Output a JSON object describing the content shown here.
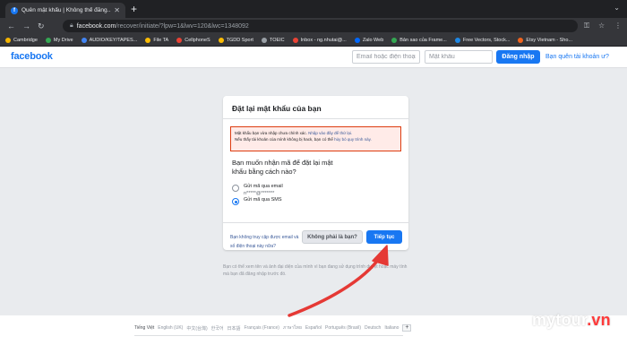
{
  "browser": {
    "tab_title": "Quên mật khẩu | Không thể đăng...",
    "url_host": "facebook.com",
    "url_path": "/recover/initiate/?lpw=1&lwv=120&lwc=1348092",
    "bookmarks": [
      {
        "label": "Cambridge",
        "color": "#f4b400"
      },
      {
        "label": "My Drive",
        "color": "#34a853"
      },
      {
        "label": "AUDIO/KEY/TAPES...",
        "color": "#4285f4"
      },
      {
        "label": "File TA",
        "color": "#fbbc05"
      },
      {
        "label": "CellphoneS",
        "color": "#e94235"
      },
      {
        "label": "TGDD Sport",
        "color": "#fbbc05"
      },
      {
        "label": "TOEIC",
        "color": "#9aa0a6"
      },
      {
        "label": "Inbox - ng.nhutai@...",
        "color": "#ea4335"
      },
      {
        "label": "Zalo Web",
        "color": "#0068ff"
      },
      {
        "label": "Bản sao của Frame...",
        "color": "#34a853"
      },
      {
        "label": "Free Vectors, Stock...",
        "color": "#1e88e5"
      },
      {
        "label": "Etsy Vietnam - Sho...",
        "color": "#f1641e"
      }
    ]
  },
  "header": {
    "logo": "facebook",
    "email_placeholder": "Email hoặc điện thoại",
    "password_placeholder": "Mật khẩu",
    "login_label": "Đăng nhập",
    "forgot_label": "Bạn quên tài khoản ư?"
  },
  "card": {
    "title": "Đặt lại mật khẩu của bạn",
    "alert_line1": "Mật khẩu bạn vừa nhập chưa chính xác.",
    "alert_link1": "Nhập vào đây để thử lại.",
    "alert_line2": "Nếu thấy tài khoản của mình không bị hack, bạn có thể",
    "alert_link2": "hủy bỏ quy trình này.",
    "question": "Bạn muốn nhận mã để đặt lại mật khẩu bằng cách nào?",
    "option_email_label": "Gửi mã qua email",
    "option_email_value": "n*****@*******",
    "option_sms_label": "Gửi mã qua SMS",
    "no_access_link": "Bạn không truy cập được email và số điện thoại này nữa?",
    "not_you_label": "Không phải là bạn?",
    "continue_label": "Tiếp tục"
  },
  "help_text": "Bạn có thể xem tên và ảnh đại diện của mình vì bạn đang sử dụng trình duyệt hoặc máy tính mà bạn đã đăng nhập trước đó.",
  "footer": {
    "languages": [
      "Tiếng Việt",
      "English (UK)",
      "中文(台灣)",
      "한국어",
      "日本語",
      "Français (France)",
      "ภาษาไทย",
      "Español",
      "Português (Brasil)",
      "Deutsch",
      "Italiano"
    ],
    "more_label": "+"
  },
  "watermark": {
    "main": "mytour",
    "accent": ".vn"
  },
  "colors": {
    "brand": "#1877f2",
    "annotation_arrow": "#e53935",
    "alert_border": "#dd3c10"
  }
}
